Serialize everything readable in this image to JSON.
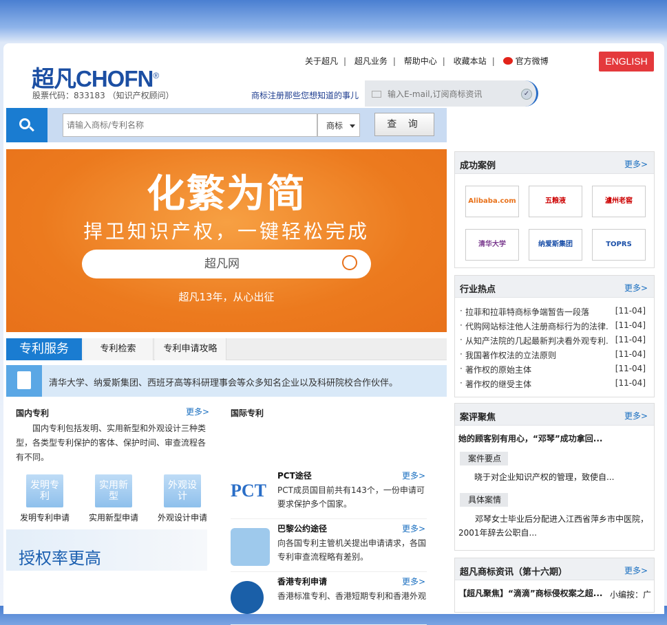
{
  "header": {
    "brand_cn": "超凡",
    "brand_en": "CHOFN",
    "reg": "®",
    "stock": "股票代码：833183 （知识产权顾问）",
    "nav": [
      "关于超凡",
      "超凡业务",
      "帮助中心",
      "收藏本站",
      "官方微博"
    ],
    "english": "ENGLISH",
    "sub_label": "商标注册那些您想知道的事儿",
    "sub_placeholder": "输入E-mail,订阅商标资讯"
  },
  "search": {
    "placeholder": "请输入商标/专利名称",
    "type": "商标",
    "button": "查 询"
  },
  "banner": {
    "title": "化繁为简",
    "slogan": "捍卫知识产权，一键轻松完成",
    "box": "超凡网",
    "footer": "超凡13年，从心出征"
  },
  "patent": {
    "tabs": [
      "专利服务",
      "专利检索",
      "专利申请攻略"
    ],
    "note": "清华大学、纳爱斯集团、西班牙高等科研理事会等众多知名企业以及科研院校合作伙伴。",
    "domestic_title": "国内专利",
    "more": "更多>",
    "domestic_desc": "国内专利包括发明、实用新型和外观设计三种类型，各类型专利保护的客体、保护时间、审查流程各有不同。",
    "types": [
      {
        "icon": "发明专利",
        "label": "发明专利申请"
      },
      {
        "icon": "实用新型",
        "label": "实用新型申请"
      },
      {
        "icon": "外观设计",
        "label": "外观设计申请"
      }
    ],
    "grant": "授权率更高",
    "intl_title": "国际专利",
    "intl": [
      {
        "title": "PCT途径",
        "desc": "PCT成员国目前共有143个，一份申请可要求保护多个国家。",
        "pic": "PCT"
      },
      {
        "title": "巴黎公约途径",
        "desc": "向各国专利主管机关提出申请请求，各国专利审查流程略有差别。",
        "pic": ""
      },
      {
        "title": "香港专利申请",
        "desc": "香港标准专利、香港短期专利和香港外观",
        "pic": ""
      }
    ]
  },
  "cases": {
    "title": "成功案例",
    "more": "更多>",
    "logos": [
      "Alibaba.com",
      "五粮液",
      "瀘州老窖",
      "清华大学",
      "纳爱斯集团",
      "TOPRS"
    ]
  },
  "hot": {
    "title": "行业热点",
    "more": "更多>",
    "items": [
      {
        "t": "拉菲和拉菲特商标争端暂告一段落",
        "d": "[11-04]"
      },
      {
        "t": "代购网站标注他人注册商标行为的法律...",
        "d": "[11-04]"
      },
      {
        "t": "从知产法院的几起最新判决看外观专利...",
        "d": "[11-04]"
      },
      {
        "t": "我国著作权法的立法原则",
        "d": "[11-04]"
      },
      {
        "t": "著作权的原始主体",
        "d": "[11-04]"
      },
      {
        "t": "著作权的继受主体",
        "d": "[11-04]"
      }
    ]
  },
  "review": {
    "title": "案评聚焦",
    "more": "更多>",
    "headline": "她的顾客别有用心，“邓琴”成功拿回...",
    "tag1": "案件要点",
    "text1": "晓于对企业知识产权的管理，致使自...",
    "tag2": "具体案情",
    "text2": "邓琴女士毕业后分配进入江西省萍乡市中医院，2001年辞去公职自..."
  },
  "news": {
    "title": "超凡商标资讯（第十六期）",
    "more": "更多>",
    "item": "【超凡聚焦】“滴滴”商标侵权案之超...",
    "side": "小编按：广"
  }
}
